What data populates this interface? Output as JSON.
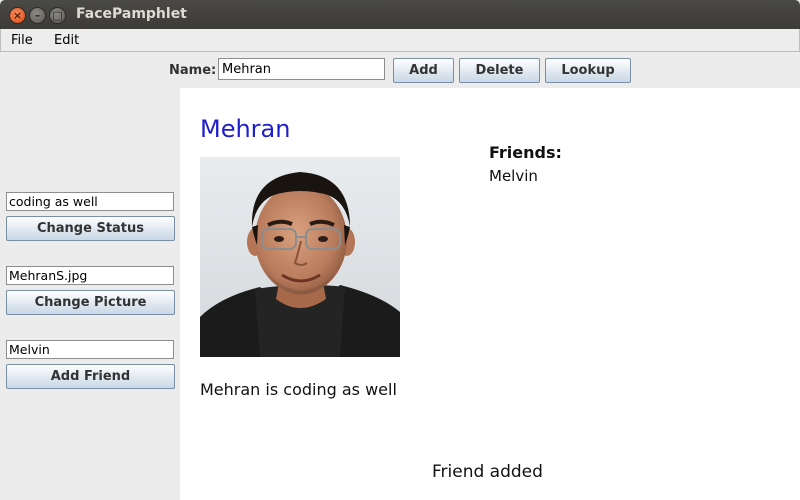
{
  "window": {
    "title": "FacePamphlet"
  },
  "menu": {
    "file": "File",
    "edit": "Edit"
  },
  "toolbar": {
    "name_label": "Name:",
    "name_value": "Mehran",
    "add_label": "Add",
    "delete_label": "Delete",
    "lookup_label": "Lookup"
  },
  "west": {
    "status_value": "coding as well",
    "change_status_label": "Change Status",
    "picture_value": "MehranS.jpg",
    "change_picture_label": "Change Picture",
    "friend_value": "Melvin",
    "add_friend_label": "Add Friend"
  },
  "profile": {
    "name": "Mehran",
    "friends_heading": "Friends:",
    "friends": [
      "Melvin"
    ],
    "status": "Mehran is coding as well",
    "message": "Friend added",
    "name_color": "#1e1ecc"
  }
}
